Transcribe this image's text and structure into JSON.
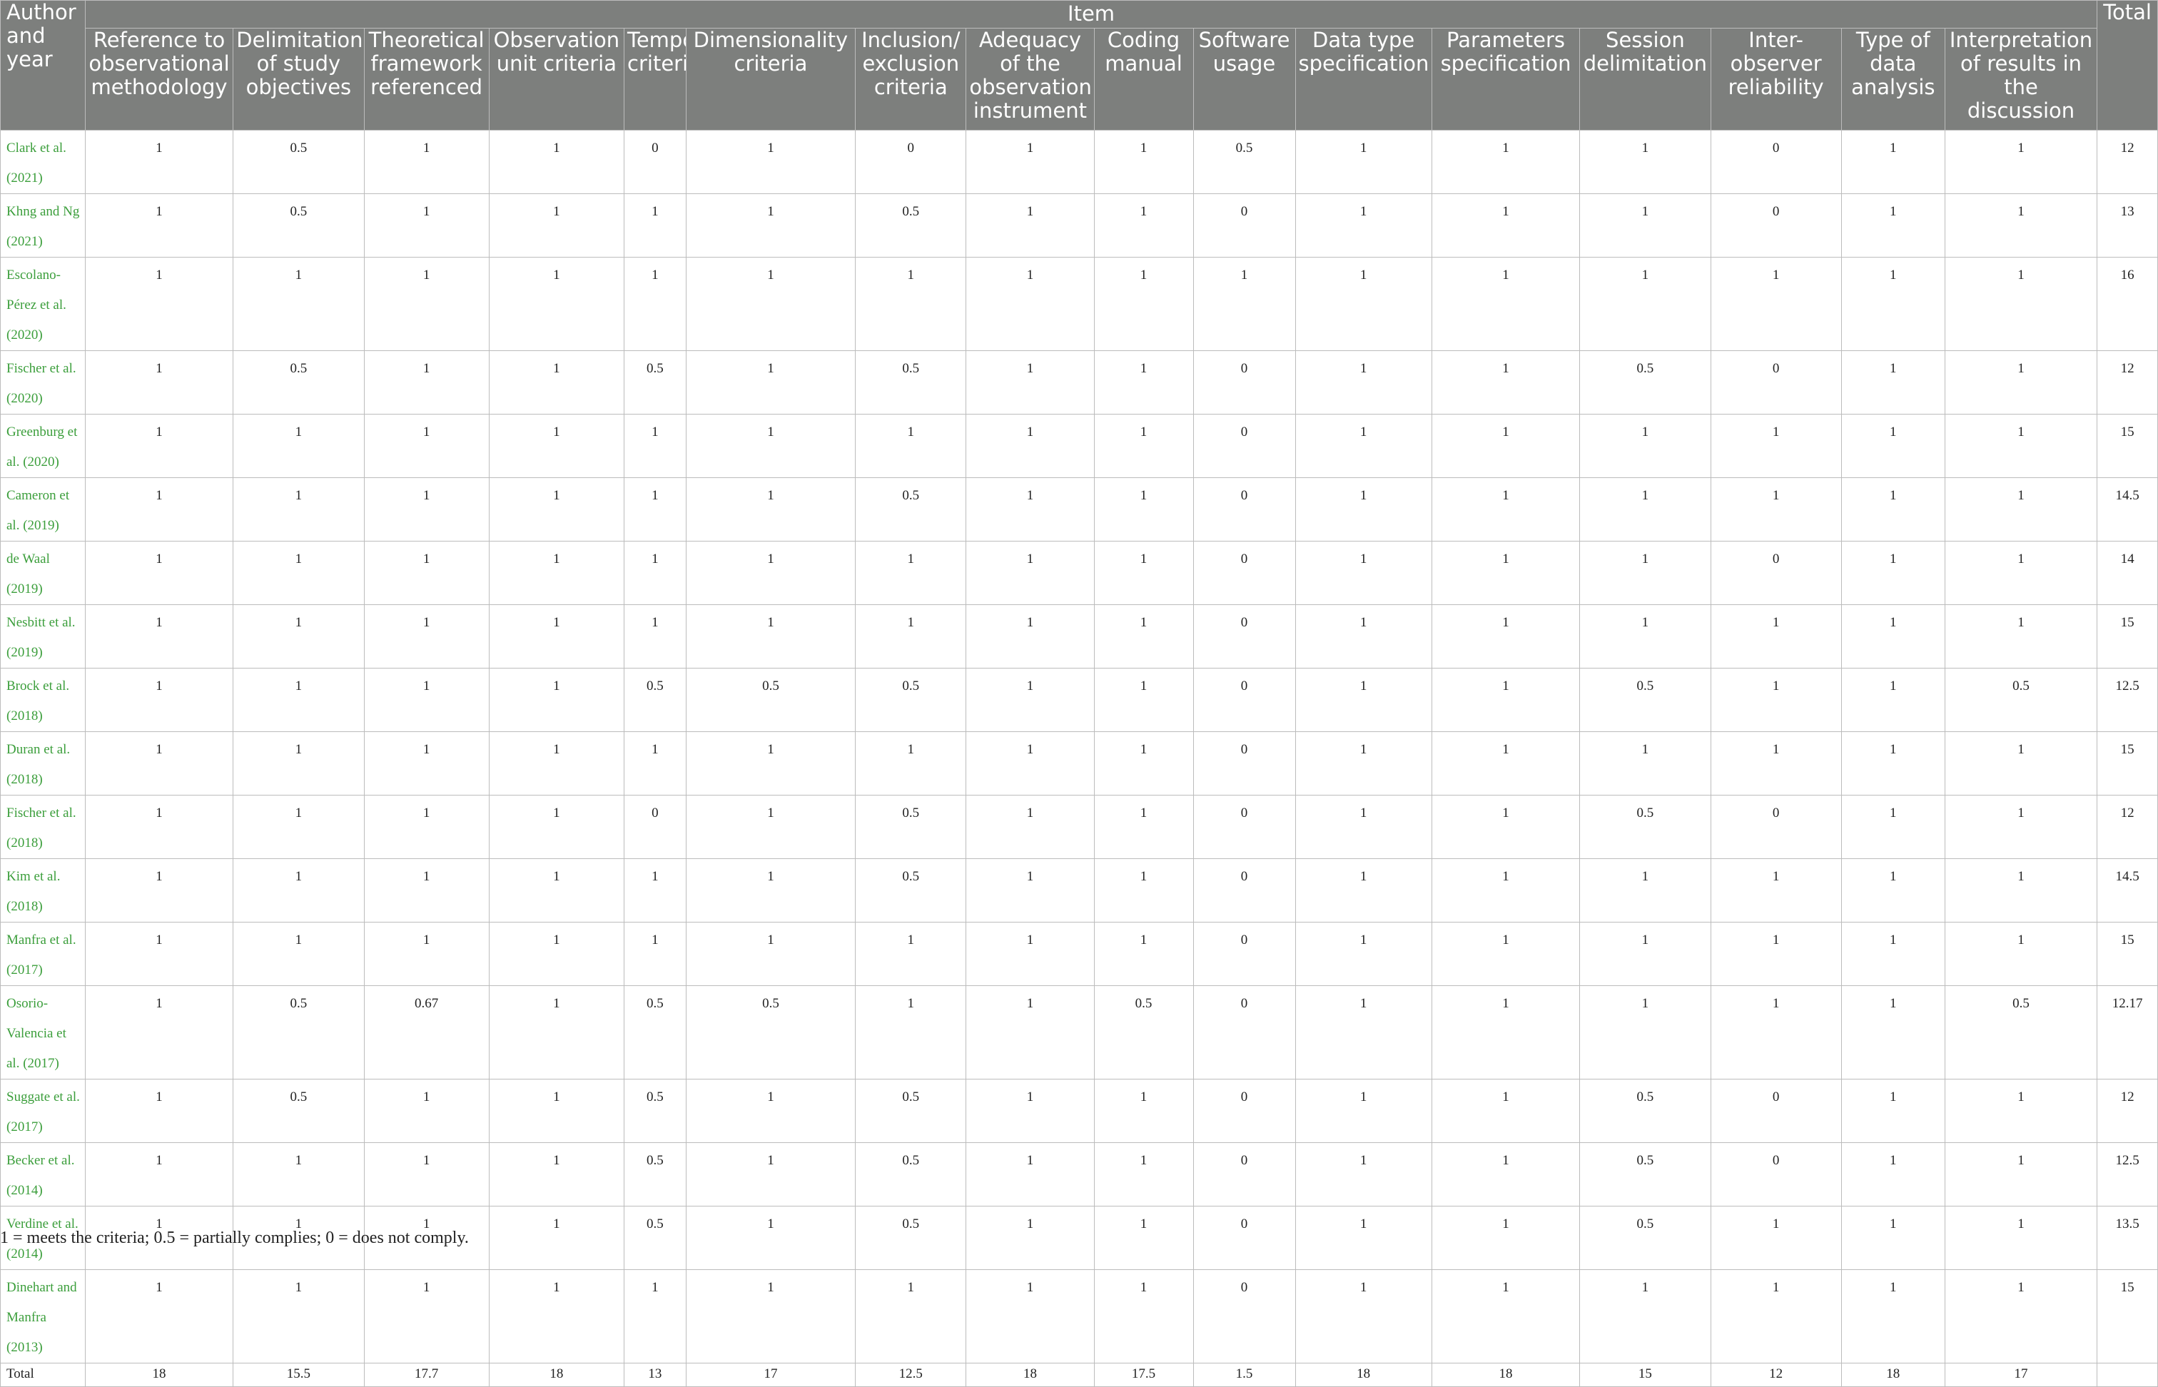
{
  "table": {
    "author_header": "Author and year",
    "item_header": "Item",
    "total_header": "Total",
    "columns": [
      "Reference to observational methodology",
      "Delimitation of study objectives",
      "Theoretical framework referenced",
      "Observation unit criteria",
      "Temporal criteria",
      "Dimensionality criteria",
      "Inclusion/ exclusion criteria",
      "Adequacy of the observation instrument",
      "Coding manual",
      "Software usage",
      "Data type specification",
      "Parameters specification",
      "Session delimitation",
      "Inter-observer reliability",
      "Type of data analysis",
      "Interpretation of results in the discussion"
    ],
    "rows": [
      {
        "author": "Clark et al. (2021)",
        "values": [
          "1",
          "0.5",
          "1",
          "1",
          "0",
          "1",
          "0",
          "1",
          "1",
          "0.5",
          "1",
          "1",
          "1",
          "0",
          "1",
          "1"
        ],
        "total": "12"
      },
      {
        "author": "Khng and Ng (2021)",
        "values": [
          "1",
          "0.5",
          "1",
          "1",
          "1",
          "1",
          "0.5",
          "1",
          "1",
          "0",
          "1",
          "1",
          "1",
          "0",
          "1",
          "1"
        ],
        "total": "13"
      },
      {
        "author": "Escolano-Pérez et al. (2020)",
        "values": [
          "1",
          "1",
          "1",
          "1",
          "1",
          "1",
          "1",
          "1",
          "1",
          "1",
          "1",
          "1",
          "1",
          "1",
          "1",
          "1"
        ],
        "total": "16"
      },
      {
        "author": "Fischer et al. (2020)",
        "values": [
          "1",
          "0.5",
          "1",
          "1",
          "0.5",
          "1",
          "0.5",
          "1",
          "1",
          "0",
          "1",
          "1",
          "0.5",
          "0",
          "1",
          "1"
        ],
        "total": "12"
      },
      {
        "author": "Greenburg et al. (2020)",
        "values": [
          "1",
          "1",
          "1",
          "1",
          "1",
          "1",
          "1",
          "1",
          "1",
          "0",
          "1",
          "1",
          "1",
          "1",
          "1",
          "1"
        ],
        "total": "15"
      },
      {
        "author": "Cameron et al. (2019)",
        "values": [
          "1",
          "1",
          "1",
          "1",
          "1",
          "1",
          "0.5",
          "1",
          "1",
          "0",
          "1",
          "1",
          "1",
          "1",
          "1",
          "1"
        ],
        "total": "14.5"
      },
      {
        "author": "de Waal (2019)",
        "values": [
          "1",
          "1",
          "1",
          "1",
          "1",
          "1",
          "1",
          "1",
          "1",
          "0",
          "1",
          "1",
          "1",
          "0",
          "1",
          "1"
        ],
        "total": "14"
      },
      {
        "author": "Nesbitt et al. (2019)",
        "values": [
          "1",
          "1",
          "1",
          "1",
          "1",
          "1",
          "1",
          "1",
          "1",
          "0",
          "1",
          "1",
          "1",
          "1",
          "1",
          "1"
        ],
        "total": "15"
      },
      {
        "author": "Brock et al. (2018)",
        "values": [
          "1",
          "1",
          "1",
          "1",
          "0.5",
          "0.5",
          "0.5",
          "1",
          "1",
          "0",
          "1",
          "1",
          "0.5",
          "1",
          "1",
          "0.5"
        ],
        "total": "12.5"
      },
      {
        "author": "Duran et al. (2018)",
        "values": [
          "1",
          "1",
          "1",
          "1",
          "1",
          "1",
          "1",
          "1",
          "1",
          "0",
          "1",
          "1",
          "1",
          "1",
          "1",
          "1"
        ],
        "total": "15"
      },
      {
        "author": "Fischer et al. (2018)",
        "values": [
          "1",
          "1",
          "1",
          "1",
          "0",
          "1",
          "0.5",
          "1",
          "1",
          "0",
          "1",
          "1",
          "0.5",
          "0",
          "1",
          "1"
        ],
        "total": "12"
      },
      {
        "author": "Kim et al. (2018)",
        "values": [
          "1",
          "1",
          "1",
          "1",
          "1",
          "1",
          "0.5",
          "1",
          "1",
          "0",
          "1",
          "1",
          "1",
          "1",
          "1",
          "1"
        ],
        "total": "14.5"
      },
      {
        "author": "Manfra et al. (2017)",
        "values": [
          "1",
          "1",
          "1",
          "1",
          "1",
          "1",
          "1",
          "1",
          "1",
          "0",
          "1",
          "1",
          "1",
          "1",
          "1",
          "1"
        ],
        "total": "15"
      },
      {
        "author": "Osorio-Valencia et al. (2017)",
        "values": [
          "1",
          "0.5",
          "0.67",
          "1",
          "0.5",
          "0.5",
          "1",
          "1",
          "0.5",
          "0",
          "1",
          "1",
          "1",
          "1",
          "1",
          "0.5"
        ],
        "total": "12.17"
      },
      {
        "author": "Suggate et al. (2017)",
        "values": [
          "1",
          "0.5",
          "1",
          "1",
          "0.5",
          "1",
          "0.5",
          "1",
          "1",
          "0",
          "1",
          "1",
          "0.5",
          "0",
          "1",
          "1"
        ],
        "total": "12"
      },
      {
        "author": "Becker et al. (2014)",
        "values": [
          "1",
          "1",
          "1",
          "1",
          "0.5",
          "1",
          "0.5",
          "1",
          "1",
          "0",
          "1",
          "1",
          "0.5",
          "0",
          "1",
          "1"
        ],
        "total": "12.5"
      },
      {
        "author": "Verdine et al. (2014)",
        "values": [
          "1",
          "1",
          "1",
          "1",
          "0.5",
          "1",
          "0.5",
          "1",
          "1",
          "0",
          "1",
          "1",
          "0.5",
          "1",
          "1",
          "1"
        ],
        "total": "13.5"
      },
      {
        "author": "Dinehart and Manfra (2013)",
        "values": [
          "1",
          "1",
          "1",
          "1",
          "1",
          "1",
          "1",
          "1",
          "1",
          "0",
          "1",
          "1",
          "1",
          "1",
          "1",
          "1"
        ],
        "total": "15"
      }
    ],
    "total_row": {
      "label": "Total",
      "values": [
        "18",
        "15.5",
        "17.7",
        "18",
        "13",
        "17",
        "12.5",
        "18",
        "17.5",
        "1.5",
        "18",
        "18",
        "15",
        "12",
        "18",
        "17"
      ],
      "total": ""
    }
  },
  "footnote": "1 = meets the criteria; 0.5 = partially complies; 0 = does not comply."
}
